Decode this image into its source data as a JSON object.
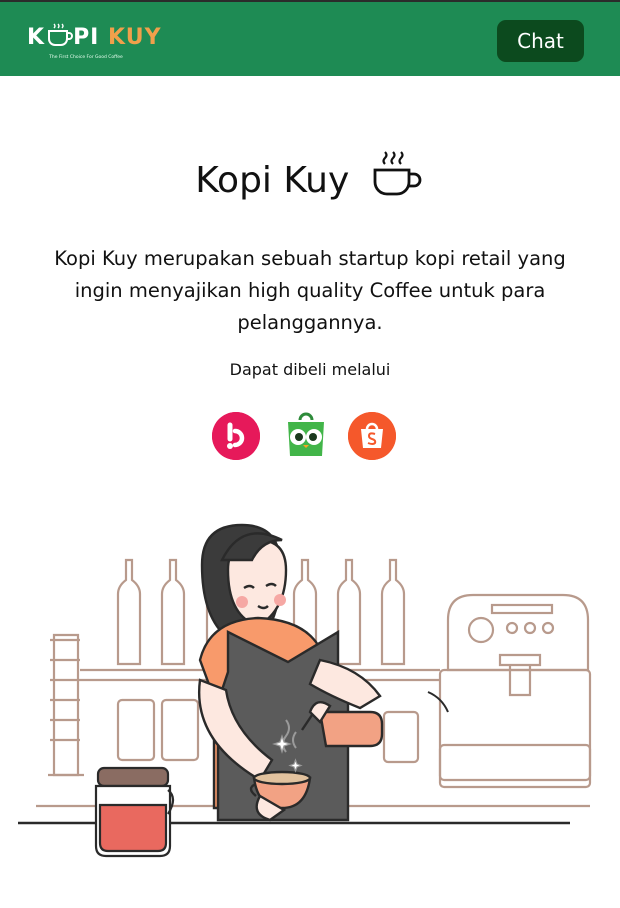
{
  "header": {
    "brand_part1": "K",
    "brand_part2": "PI",
    "brand_part3": "KUY",
    "tagline": "The First Choice For Good Coffee",
    "chat_label": "Chat"
  },
  "hero": {
    "title": "Kopi Kuy",
    "description": "Kopi Kuy merupakan sebuah startup kopi retail yang ingin menyajikan high quality Coffee untuk para pelanggannya.",
    "buy_label": "Dapat dibeli melalui"
  },
  "stores": [
    {
      "name": "Blibli",
      "icon": "blibli-icon",
      "color": "#e6195a"
    },
    {
      "name": "Tokopedia",
      "icon": "tokopedia-icon",
      "color": "#42b549"
    },
    {
      "name": "Shopee",
      "icon": "shopee-icon",
      "color": "#f5582b"
    }
  ],
  "colors": {
    "header_bg": "#1e8b54",
    "chat_btn_bg": "#0c4a1e",
    "accent_orange": "#f0a04b"
  }
}
